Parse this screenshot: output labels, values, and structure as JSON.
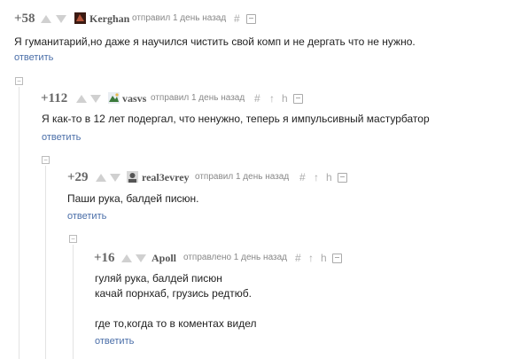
{
  "comments": [
    {
      "rating": "+58",
      "author": "Kerghan",
      "meta": "отправил 1 день назад",
      "lines": [
        "Я гуманитарий,но даже я научился чистить свой комп и не дергать что не нужно."
      ],
      "reply": "ответить"
    },
    {
      "rating": "+112",
      "author": "vasvs",
      "meta": "отправил 1 день назад",
      "lines": [
        "Я как-то в 12 лет подергал, что ненужно, теперь я импульсивный мастурбатор"
      ],
      "reply": "ответить"
    },
    {
      "rating": "+29",
      "author": "real3evrey",
      "meta": "отправил 1 день назад",
      "lines": [
        "Паши рука, балдей писюн."
      ],
      "reply": "ответить"
    },
    {
      "rating": "+16",
      "author": "Apoll",
      "meta": "отправлено 1 день назад",
      "lines": [
        "гуляй рука, балдей писюн",
        "качай порнхаб, грузись редтюб.",
        "",
        "где то,когда то в коментах видел"
      ],
      "reply": "ответить"
    }
  ],
  "icons": {
    "hash": "#",
    "pin": "↑",
    "link": "h",
    "collapse": "−"
  },
  "colors": {
    "link": "#4a6ea8",
    "vote_arrow": "#d0d0d0",
    "rating": "#666666"
  }
}
